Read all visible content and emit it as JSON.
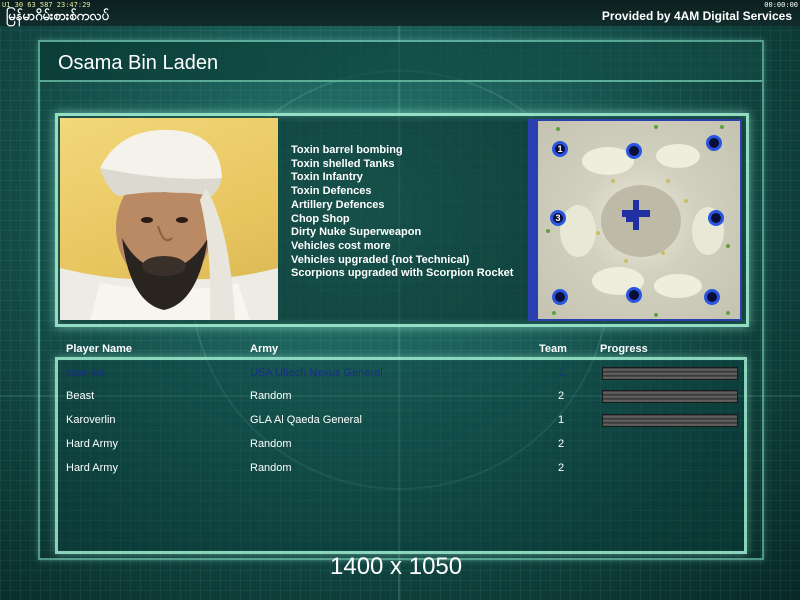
{
  "top_bar": {
    "status": "U1 30 63 587 23:47:29",
    "clock": "00:00:00",
    "brand": "မြန်မာဂိမ်းစားစ်ကလပ်",
    "provided_by": "Provided by 4AM Digital Services"
  },
  "general": {
    "name": "Osama Bin Laden",
    "features": [
      "Toxin barrel bombing",
      "Toxin shelled Tanks",
      "Toxin Infantry",
      "Toxin Defences",
      "Artillery Defences",
      "Chop Shop",
      "Dirty Nuke Superweapon",
      "Vehicles cost more",
      "Vehicles upgraded {not Technical)",
      "Scorpions upgraded with Scorpion Rocket"
    ]
  },
  "minimap": {
    "start_positions": [
      "1",
      "",
      "",
      "3",
      "",
      "",
      "",
      "",
      ""
    ]
  },
  "players_table": {
    "headers": {
      "name": "Player Name",
      "army": "Army",
      "team": "Team",
      "progress": "Progress"
    },
    "rows": [
      {
        "name": "moe lee",
        "army": "USA Ultech Nexus General",
        "team": "1",
        "progress": 1.0,
        "dim": true
      },
      {
        "name": "Beast",
        "army": "Random",
        "team": "2",
        "progress": 1.0,
        "dim": false
      },
      {
        "name": "Karoverlin",
        "army": "GLA Al Qaeda General",
        "team": "1",
        "progress": 1.0,
        "dim": false
      },
      {
        "name": "Hard Army",
        "army": "Random",
        "team": "2",
        "progress": null,
        "dim": false
      },
      {
        "name": "Hard Army",
        "army": "Random",
        "team": "2",
        "progress": null,
        "dim": false
      }
    ]
  },
  "resolution_label": "1400 x 1050",
  "colors": {
    "frame_glow": "#aafadc",
    "minimap_border": "#2a3fb0",
    "dim_row_text": "#1a2c8a"
  }
}
